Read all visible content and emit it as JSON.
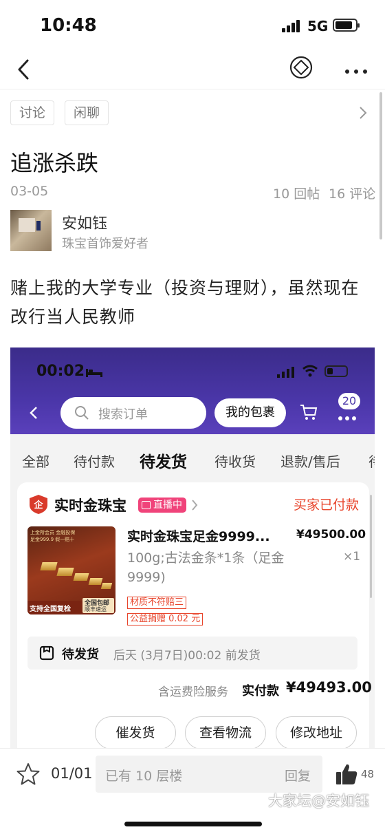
{
  "status": {
    "time": "10:48",
    "network": "5G"
  },
  "tags": [
    "讨论",
    "闲聊"
  ],
  "post": {
    "title": "追涨杀跌",
    "date": "03-05",
    "replies": "10 回帖",
    "comments": "16 评论",
    "author_name": "安如钰",
    "author_role": "珠宝首饰爱好者",
    "body": "赌上我的大学专业（投资与理财），虽然现在改行当人民教师"
  },
  "shot": {
    "time": "00:02",
    "search_placeholder": "搜索订单",
    "my_package": "我的包裹",
    "cart_badge": "20",
    "tabs": [
      "全部",
      "待付款",
      "待发货",
      "待收货",
      "退款/售后",
      "待"
    ],
    "active_tab_index": 2,
    "shop_logo_text": "企",
    "shop_name": "实时金珠宝",
    "live_badge": "直播中",
    "order_status": "买家已付款",
    "product_title": "实时金珠宝足金9999...",
    "product_price": "¥49500.00",
    "product_spec": "100g;古法金条*1条（足金9999)",
    "product_qty": "×1",
    "promo1": "材质不符赔三",
    "promo2": "公益捐赠 0.02 元",
    "thumb_top_left": "上金所会员 金融投保",
    "thumb_top_right": "足金999.9 假一赔十",
    "thumb_bottom_left": "支持全国复检",
    "thumb_bottom_right": "全国包邮",
    "thumb_courier": "顺丰速运",
    "ship_label": "待发货",
    "ship_deadline": "后天 (3月7日)00:02 前发货",
    "insurance_text": "含运费险服务",
    "actual_pay_label": "实付款",
    "actual_pay_value": "¥49493.00",
    "buttons": [
      "催发货",
      "查看物流",
      "修改地址"
    ]
  },
  "bottom": {
    "page_indicator": "01/01",
    "input_placeholder": "已有 10 层楼",
    "reply_label": "回复",
    "like_count": "48"
  },
  "watermark": "大家坛@安如钰",
  "colors": {
    "accent_red": "#e8452c",
    "purple": "#4a36a8",
    "live_pink": "#f0437a"
  }
}
